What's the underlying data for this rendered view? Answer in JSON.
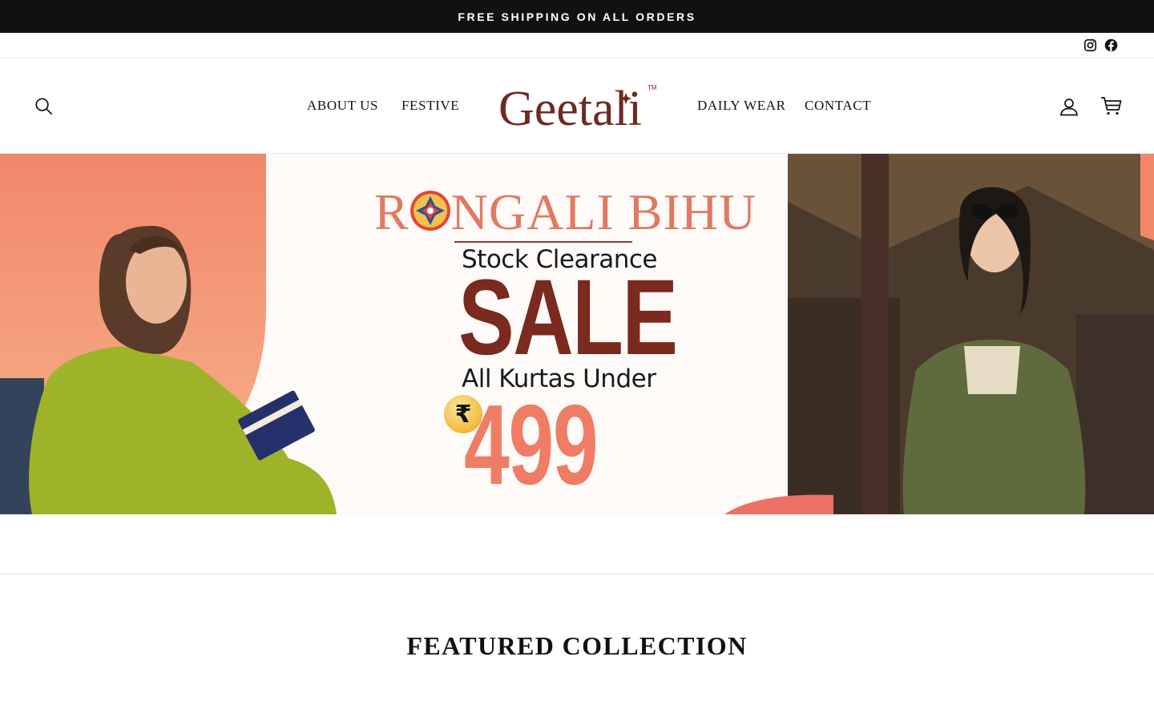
{
  "announcement": {
    "text": "FREE SHIPPING ON ALL ORDERS"
  },
  "social": [
    {
      "name": "Instagram",
      "icon": "instagram-icon"
    },
    {
      "name": "Facebook",
      "icon": "facebook-icon"
    }
  ],
  "header": {
    "logo_text": "Geetali",
    "logo_mark": "TM",
    "nav_left": [
      {
        "label": "ABOUT US"
      },
      {
        "label": "FESTIVE"
      }
    ],
    "nav_right": [
      {
        "label": "DAILY WEAR"
      },
      {
        "label": "CONTACT"
      }
    ],
    "icons": {
      "search": "search-icon",
      "account": "user-icon",
      "cart": "cart-icon"
    }
  },
  "hero": {
    "title_left": "R",
    "title_right": "NGALI BIHU",
    "subtitle": "Stock Clearance",
    "headline": "SALE",
    "offer_line": "All Kurtas Under",
    "currency_symbol": "₹",
    "price": "499",
    "colors": {
      "peach": "#f2876a",
      "maroon": "#7a2a1f",
      "coral": "#ef7d66"
    }
  },
  "featured": {
    "heading": "FEATURED COLLECTION"
  }
}
